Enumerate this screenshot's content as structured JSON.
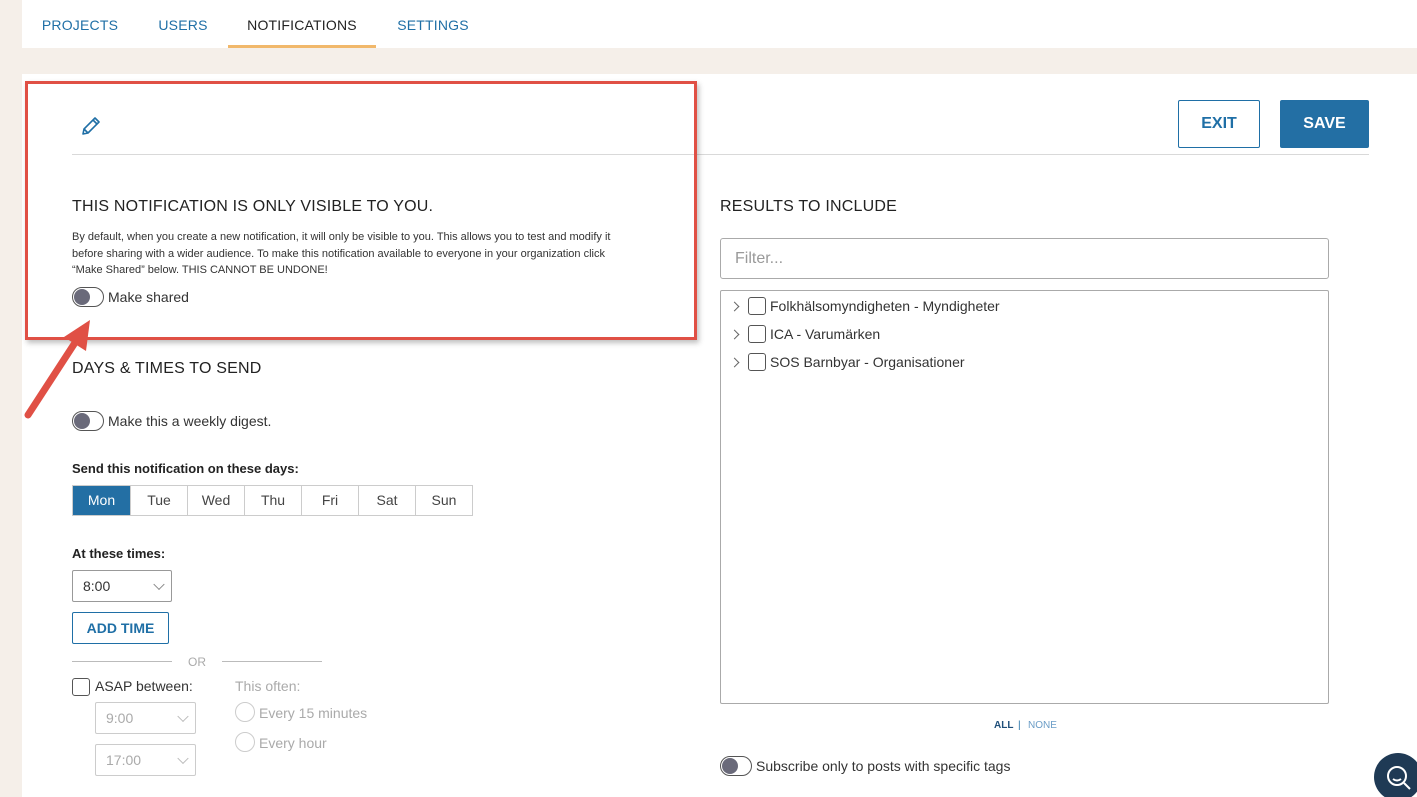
{
  "tabs": [
    {
      "label": "PROJECTS"
    },
    {
      "label": "USERS"
    },
    {
      "label": "NOTIFICATIONS"
    },
    {
      "label": "SETTINGS"
    }
  ],
  "active_tab": "NOTIFICATIONS",
  "header": {
    "exit_label": "EXIT",
    "save_label": "SAVE"
  },
  "visibility": {
    "title": "THIS NOTIFICATION IS ONLY VISIBLE TO YOU.",
    "description_lines": [
      "By default, when you create a new notification, it will only be visible to you. This allows you to test and modify it",
      "before sharing with a wider audience. To make this notification available to everyone in your organization click",
      "“Make Shared” below. THIS CANNOT BE UNDONE!"
    ],
    "make_shared_label": "Make shared"
  },
  "schedule": {
    "title": "DAYS & TIMES TO SEND",
    "weekly_digest_label": "Make this a weekly digest.",
    "days_label": "Send this notification on these days:",
    "days": [
      {
        "label": "Mon",
        "selected": true
      },
      {
        "label": "Tue",
        "selected": false
      },
      {
        "label": "Wed",
        "selected": false
      },
      {
        "label": "Thu",
        "selected": false
      },
      {
        "label": "Fri",
        "selected": false
      },
      {
        "label": "Sat",
        "selected": false
      },
      {
        "label": "Sun",
        "selected": false
      }
    ],
    "times_label": "At these times:",
    "time_value": "8:00",
    "add_time_label": "ADD TIME",
    "or_label": "OR",
    "asap_label": "ASAP between:",
    "asap_from": "9:00",
    "asap_to": "17:00",
    "frequency_label": "This often:",
    "frequency_options": [
      "Every 15 minutes",
      "Every hour"
    ]
  },
  "results": {
    "title": "RESULTS TO INCLUDE",
    "filter_placeholder": "Filter...",
    "items": [
      {
        "label": "Folkhälsomyndigheten - Myndigheter"
      },
      {
        "label": "ICA - Varumärken"
      },
      {
        "label": "SOS Barnbyar - Organisationer"
      }
    ],
    "all_label": "ALL",
    "separator": "|",
    "none_label": "NONE",
    "subscribe_tags_label": "Subscribe only to posts with specific tags"
  },
  "colors": {
    "accent": "#236fa4",
    "tab_underline": "#f1b86b",
    "annotation": "#e05045"
  },
  "icons": [
    "pencil-icon",
    "chevron-down-icon",
    "chevron-right-icon",
    "search-chat-icon"
  ]
}
